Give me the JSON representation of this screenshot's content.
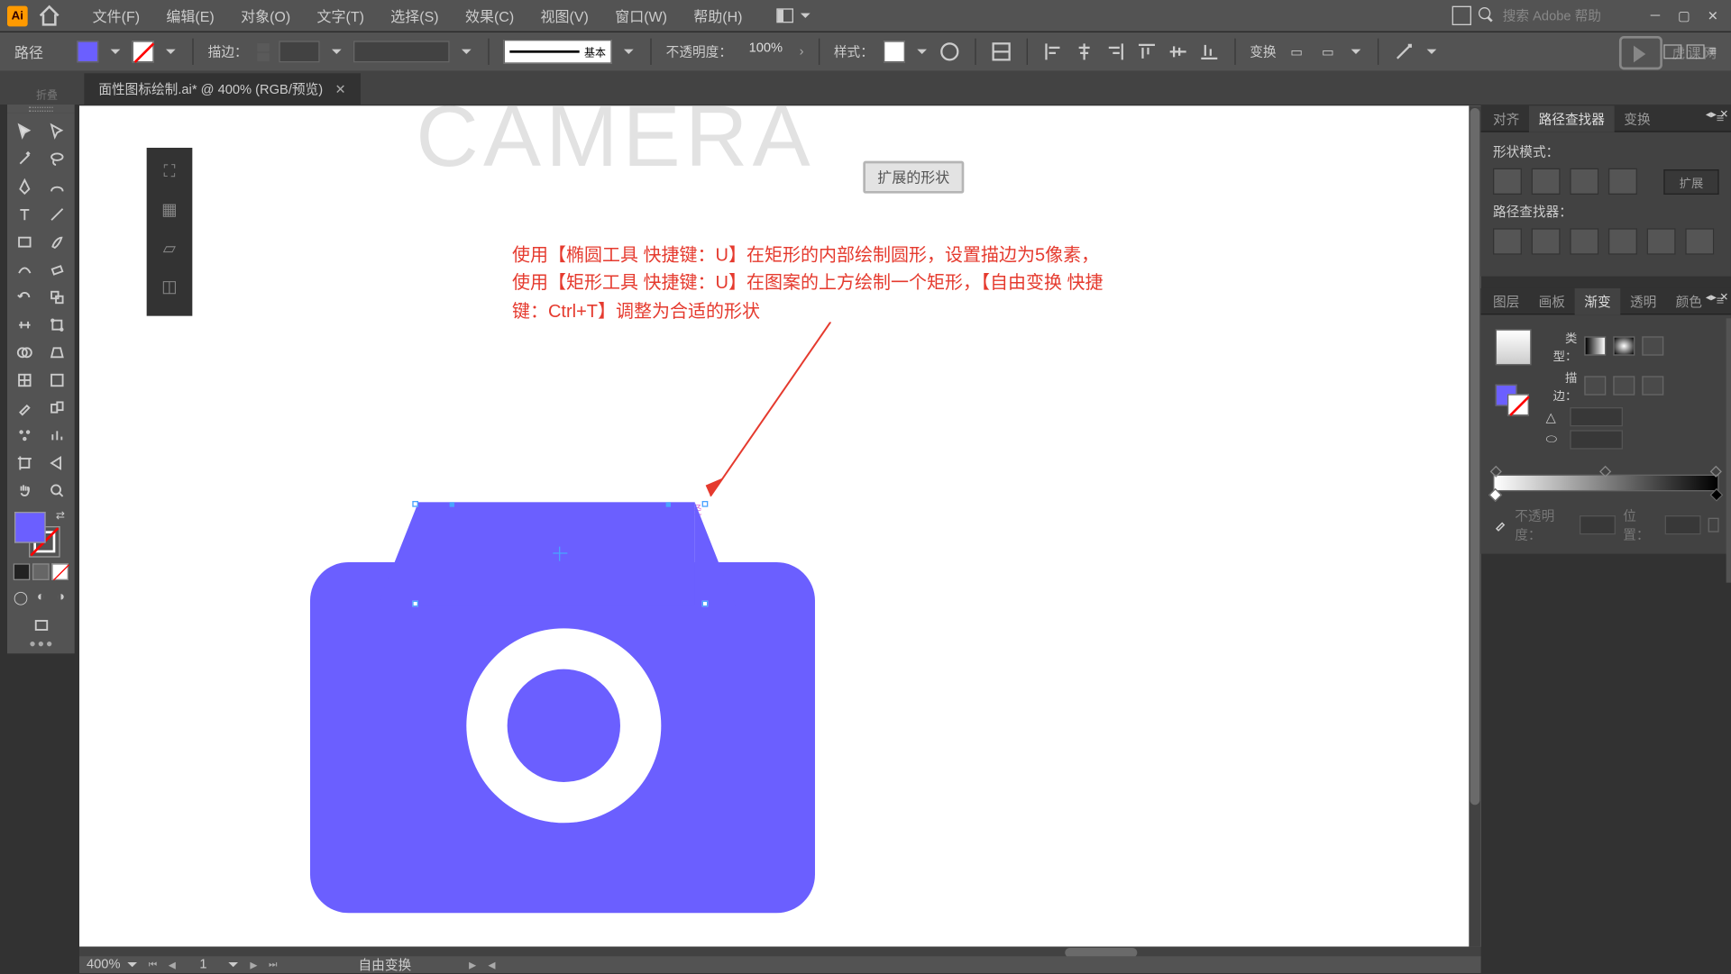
{
  "menu": {
    "file": "文件(F)",
    "edit": "编辑(E)",
    "object": "对象(O)",
    "text": "文字(T)",
    "select": "选择(S)",
    "effect": "效果(C)",
    "view": "视图(V)",
    "window": "窗口(W)",
    "help": "帮助(H)"
  },
  "search_placeholder": "搜索 Adobe 帮助",
  "control": {
    "selection_label": "路径",
    "stroke_label": "描边：",
    "basic": "基本",
    "opacity_label": "不透明度：",
    "opacity_value": "100%",
    "style_label": "样式：",
    "transform_label": "变换"
  },
  "tab": {
    "title": "面性图标绘制.ai* @ 400% (RGB/预览)"
  },
  "status": {
    "zoom": "400%",
    "page": "1",
    "mode": "自由变换"
  },
  "panel_align": {
    "t1": "对齐",
    "t2": "路径查找器",
    "t3": "变换",
    "shape_mode": "形状模式：",
    "pathfinder": "路径查找器：",
    "expand": "扩展"
  },
  "panel_grad": {
    "t1": "图层",
    "t2": "画板",
    "t3": "渐变",
    "t4": "透明",
    "t5": "颜色",
    "type": "类型：",
    "stroke": "描边：",
    "opacity": "不透明度：",
    "location": "位置："
  },
  "canvas": {
    "faded": "CAMERA",
    "badge": "扩展的形状",
    "path_label": "路径",
    "instruction": "使用【椭圆工具 快捷键：U】在矩形的内部绘制圆形，设置描边为5像素，使用【矩形工具 快捷键：U】在图案的上方绘制一个矩形，【自由变换 快捷键：Ctrl+T】调整为合适的形状"
  },
  "watermark": "虎课网",
  "ui": {
    "dock": "折叠"
  }
}
